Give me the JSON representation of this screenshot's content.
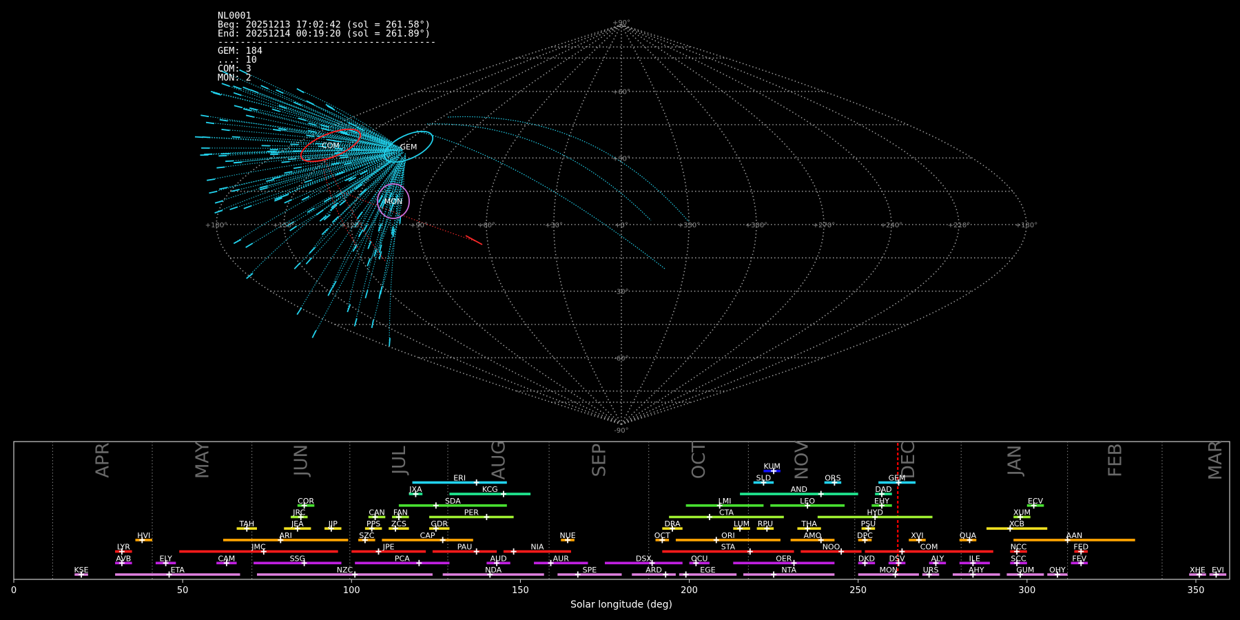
{
  "info": {
    "lines": [
      "NL0001",
      "Beg: 20251213 17:02:42 (sol = 261.58°)",
      "End: 20251214 00:19:20 (sol = 261.89°)",
      "---------------------------------------",
      "GEM: 184",
      "...: 10",
      "COM: 3",
      "MON: 2"
    ]
  },
  "colors": {
    "background": "#000000",
    "grid": "#9a9a9a",
    "meteor_gem": "#22d3ee",
    "meteor_com": "#ff2a2a",
    "radiant_gem": "#22d3ee",
    "radiant_com": "#ff2020",
    "radiant_mon": "#d070e0",
    "current_sol": "#ff0000"
  },
  "map": {
    "projection": "sinusoidal",
    "lat_labels": [
      "+90°",
      "+60°",
      "+30°",
      "-30°",
      "-60°",
      "-90°"
    ],
    "lon_labels": [
      "+180°",
      "+150°",
      "+120°",
      "+90°",
      "+60°",
      "+30°",
      "+0°",
      "+330°",
      "+300°",
      "+270°",
      "+240°",
      "+210°",
      "+180°"
    ],
    "radiants": [
      {
        "name": "COM",
        "color": "#ff2020"
      },
      {
        "name": "GEM",
        "color": "#22d3ee"
      },
      {
        "name": "MON",
        "color": "#d070e0"
      }
    ]
  },
  "chart_data": {
    "type": "timeline",
    "xlabel": "Solar longitude (deg)",
    "xlim": [
      0,
      360
    ],
    "xticks": [
      0,
      50,
      100,
      150,
      200,
      250,
      300,
      350
    ],
    "current_sol": [
      261.58,
      261.89
    ],
    "months": [
      {
        "name": "APR",
        "start": 11.5,
        "end": 41
      },
      {
        "name": "MAY",
        "start": 41,
        "end": 70.5
      },
      {
        "name": "JUN",
        "start": 70.5,
        "end": 99.5
      },
      {
        "name": "JUL",
        "start": 99.5,
        "end": 128.5
      },
      {
        "name": "AUG",
        "start": 128.5,
        "end": 158.5
      },
      {
        "name": "SEP",
        "start": 158.5,
        "end": 188
      },
      {
        "name": "OCT",
        "start": 188,
        "end": 217.5
      },
      {
        "name": "NOV",
        "start": 217.5,
        "end": 249
      },
      {
        "name": "DEC",
        "start": 249,
        "end": 280.5
      },
      {
        "name": "JAN",
        "start": 280.5,
        "end": 312
      },
      {
        "name": "FEB",
        "start": 312,
        "end": 340
      },
      {
        "name": "MAR",
        "start": 340,
        "end": 371.5
      }
    ],
    "showers": [
      {
        "name": "KUM",
        "start": 222,
        "end": 227,
        "peak": 225,
        "row": 9,
        "color": "#1010ff"
      },
      {
        "name": "ERI",
        "start": 118,
        "end": 146,
        "peak": 137,
        "row": 8,
        "color": "#22d3ee"
      },
      {
        "name": "SLD",
        "start": 219,
        "end": 225,
        "peak": 222,
        "row": 8,
        "color": "#22d3ee"
      },
      {
        "name": "ORS",
        "start": 240,
        "end": 245,
        "peak": 243,
        "row": 8,
        "color": "#22d3ee"
      },
      {
        "name": "GEM",
        "start": 256,
        "end": 267,
        "peak": 262,
        "row": 8,
        "color": "#22d3ee"
      },
      {
        "name": "JXA",
        "start": 117,
        "end": 121,
        "peak": 119,
        "row": 7,
        "color": "#20e890"
      },
      {
        "name": "KCG",
        "start": 129,
        "end": 153,
        "peak": 145,
        "row": 7,
        "color": "#20e890"
      },
      {
        "name": "AND",
        "start": 215,
        "end": 250,
        "peak": 239,
        "row": 7,
        "color": "#20e890"
      },
      {
        "name": "DAD",
        "start": 255,
        "end": 260,
        "peak": 257,
        "row": 7,
        "color": "#20e890"
      },
      {
        "name": "COR",
        "start": 84,
        "end": 89,
        "peak": 86,
        "row": 6,
        "color": "#48e030"
      },
      {
        "name": "SDA",
        "start": 114,
        "end": 146,
        "peak": 125,
        "row": 6,
        "color": "#48e030"
      },
      {
        "name": "LMI",
        "start": 199,
        "end": 222,
        "peak": 209,
        "row": 6,
        "color": "#48e030"
      },
      {
        "name": "LEO",
        "start": 224,
        "end": 246,
        "peak": 235,
        "row": 6,
        "color": "#48e030"
      },
      {
        "name": "EHY",
        "start": 254,
        "end": 260,
        "peak": 257,
        "row": 6,
        "color": "#48e030"
      },
      {
        "name": "ECV",
        "start": 300,
        "end": 305,
        "peak": 302,
        "row": 6,
        "color": "#48e030"
      },
      {
        "name": "JRC",
        "start": 82,
        "end": 87,
        "peak": 85,
        "row": 5,
        "color": "#a0f030"
      },
      {
        "name": "CAN",
        "start": 105,
        "end": 110,
        "peak": 107,
        "row": 5,
        "color": "#a0f030"
      },
      {
        "name": "FAN",
        "start": 112,
        "end": 117,
        "peak": 114,
        "row": 5,
        "color": "#a0f030"
      },
      {
        "name": "PER",
        "start": 123,
        "end": 148,
        "peak": 140,
        "row": 5,
        "color": "#a0f030"
      },
      {
        "name": "CTA",
        "start": 194,
        "end": 228,
        "peak": 206,
        "row": 5,
        "color": "#a0f030"
      },
      {
        "name": "HYD",
        "start": 238,
        "end": 272,
        "peak": 255,
        "row": 5,
        "color": "#a0f030"
      },
      {
        "name": "XUM",
        "start": 296,
        "end": 301,
        "peak": 298,
        "row": 5,
        "color": "#a0f030"
      },
      {
        "name": "TAH",
        "start": 66,
        "end": 72,
        "peak": 69,
        "row": 4,
        "color": "#f0e020"
      },
      {
        "name": "JEA",
        "start": 80,
        "end": 88,
        "peak": 84,
        "row": 4,
        "color": "#f0e020"
      },
      {
        "name": "JIP",
        "start": 92,
        "end": 97,
        "peak": 94,
        "row": 4,
        "color": "#f0e020"
      },
      {
        "name": "PPS",
        "start": 104,
        "end": 109,
        "peak": 106,
        "row": 4,
        "color": "#f0e020"
      },
      {
        "name": "ZCS",
        "start": 111,
        "end": 117,
        "peak": 113,
        "row": 4,
        "color": "#f0e020"
      },
      {
        "name": "GDR",
        "start": 123,
        "end": 129,
        "peak": 125,
        "row": 4,
        "color": "#f0e020"
      },
      {
        "name": "DRA",
        "start": 192,
        "end": 198,
        "peak": 195,
        "row": 4,
        "color": "#f0e020"
      },
      {
        "name": "LUM",
        "start": 213,
        "end": 218,
        "peak": 215,
        "row": 4,
        "color": "#f0e020"
      },
      {
        "name": "RPU",
        "start": 220,
        "end": 225,
        "peak": 223,
        "row": 4,
        "color": "#f0e020"
      },
      {
        "name": "THA",
        "start": 232,
        "end": 239,
        "peak": 235,
        "row": 4,
        "color": "#f0e020"
      },
      {
        "name": "PSU",
        "start": 251,
        "end": 255,
        "peak": 253,
        "row": 4,
        "color": "#f0e020"
      },
      {
        "name": "XCB",
        "start": 288,
        "end": 306,
        "peak": 295,
        "row": 4,
        "color": "#f0e020"
      },
      {
        "name": "HVI",
        "start": 36,
        "end": 41,
        "peak": 38,
        "row": 3,
        "color": "#ffa500"
      },
      {
        "name": "ARI",
        "start": 62,
        "end": 99,
        "peak": 79,
        "row": 3,
        "color": "#ffa500"
      },
      {
        "name": "SZC",
        "start": 102,
        "end": 107,
        "peak": 104,
        "row": 3,
        "color": "#ffa500"
      },
      {
        "name": "CAP",
        "start": 109,
        "end": 136,
        "peak": 127,
        "row": 3,
        "color": "#ffa500"
      },
      {
        "name": "NUE",
        "start": 162,
        "end": 166,
        "peak": 164,
        "row": 3,
        "color": "#ffa500"
      },
      {
        "name": "OCT",
        "start": 190,
        "end": 194,
        "peak": 192,
        "row": 3,
        "color": "#ffa500"
      },
      {
        "name": "ORI",
        "start": 196,
        "end": 227,
        "peak": 208,
        "row": 3,
        "color": "#ffa500"
      },
      {
        "name": "AMO",
        "start": 230,
        "end": 243,
        "peak": 239,
        "row": 3,
        "color": "#ffa500"
      },
      {
        "name": "DPC",
        "start": 250,
        "end": 254,
        "peak": 252,
        "row": 3,
        "color": "#ffa500"
      },
      {
        "name": "XVI",
        "start": 265,
        "end": 270,
        "peak": 268,
        "row": 3,
        "color": "#ffa500"
      },
      {
        "name": "QUA",
        "start": 280,
        "end": 285,
        "peak": 283,
        "row": 3,
        "color": "#ffa500"
      },
      {
        "name": "AAN",
        "start": 296,
        "end": 332,
        "peak": 312,
        "row": 3,
        "color": "#ffa500"
      },
      {
        "name": "LYR",
        "start": 30,
        "end": 35,
        "peak": 32,
        "row": 2,
        "color": "#ff1a1a"
      },
      {
        "name": "JMC",
        "start": 49,
        "end": 96,
        "peak": 74,
        "row": 2,
        "color": "#ff1a1a"
      },
      {
        "name": "JPE",
        "start": 100,
        "end": 122,
        "peak": 108,
        "row": 2,
        "color": "#ff1a1a"
      },
      {
        "name": "PAU",
        "start": 124,
        "end": 143,
        "peak": 137,
        "row": 2,
        "color": "#ff1a1a"
      },
      {
        "name": "NIA",
        "start": 145,
        "end": 165,
        "peak": 148,
        "row": 2,
        "color": "#ff1a1a"
      },
      {
        "name": "STA",
        "start": 192,
        "end": 231,
        "peak": 218,
        "row": 2,
        "color": "#ff1a1a"
      },
      {
        "name": "NOO",
        "start": 233,
        "end": 251,
        "peak": 245,
        "row": 2,
        "color": "#ff1a1a"
      },
      {
        "name": "COM",
        "start": 252,
        "end": 290,
        "peak": 263,
        "row": 2,
        "color": "#ff1a1a"
      },
      {
        "name": "NCC",
        "start": 295,
        "end": 300,
        "peak": 297,
        "row": 2,
        "color": "#ff1a1a"
      },
      {
        "name": "FED",
        "start": 314,
        "end": 318,
        "peak": 316,
        "row": 2,
        "color": "#ff1a1a"
      },
      {
        "name": "AVB",
        "start": 30,
        "end": 35,
        "peak": 32,
        "row": 1,
        "color": "#c020e0"
      },
      {
        "name": "ELY",
        "start": 42,
        "end": 48,
        "peak": 45,
        "row": 1,
        "color": "#c020e0"
      },
      {
        "name": "CAM",
        "start": 60,
        "end": 66,
        "peak": 63,
        "row": 1,
        "color": "#c020e0"
      },
      {
        "name": "SSG",
        "start": 71,
        "end": 97,
        "peak": 86,
        "row": 1,
        "color": "#c020e0"
      },
      {
        "name": "PCA",
        "start": 101,
        "end": 129,
        "peak": 120,
        "row": 1,
        "color": "#c020e0"
      },
      {
        "name": "AUD",
        "start": 140,
        "end": 147,
        "peak": 143,
        "row": 1,
        "color": "#c020e0"
      },
      {
        "name": "AUR",
        "start": 154,
        "end": 170,
        "peak": 159,
        "row": 1,
        "color": "#c020e0"
      },
      {
        "name": "DSX",
        "start": 175,
        "end": 198,
        "peak": 189,
        "row": 1,
        "color": "#c020e0"
      },
      {
        "name": "OCU",
        "start": 200,
        "end": 206,
        "peak": 202,
        "row": 1,
        "color": "#c020e0"
      },
      {
        "name": "OER",
        "start": 213,
        "end": 243,
        "peak": 231,
        "row": 1,
        "color": "#c020e0"
      },
      {
        "name": "DKD",
        "start": 250,
        "end": 255,
        "peak": 252,
        "row": 1,
        "color": "#c020e0"
      },
      {
        "name": "DSV",
        "start": 259,
        "end": 264,
        "peak": 262,
        "row": 1,
        "color": "#c020e0"
      },
      {
        "name": "ALY",
        "start": 271,
        "end": 276,
        "peak": 273,
        "row": 1,
        "color": "#c020e0"
      },
      {
        "name": "ILE",
        "start": 280,
        "end": 289,
        "peak": 284,
        "row": 1,
        "color": "#c020e0"
      },
      {
        "name": "SCC",
        "start": 295,
        "end": 300,
        "peak": 297,
        "row": 1,
        "color": "#c020e0"
      },
      {
        "name": "FEV",
        "start": 313,
        "end": 318,
        "peak": 316,
        "row": 1,
        "color": "#c020e0"
      },
      {
        "name": "KSE",
        "start": 18,
        "end": 22,
        "peak": 20,
        "row": 0,
        "color": "#e080e0"
      },
      {
        "name": "ETA",
        "start": 30,
        "end": 67,
        "peak": 46,
        "row": 0,
        "color": "#e080e0"
      },
      {
        "name": "NZC",
        "start": 72,
        "end": 124,
        "peak": 101,
        "row": 0,
        "color": "#e080e0"
      },
      {
        "name": "NDA",
        "start": 127,
        "end": 157,
        "peak": 141,
        "row": 0,
        "color": "#e080e0"
      },
      {
        "name": "SPE",
        "start": 161,
        "end": 180,
        "peak": 167,
        "row": 0,
        "color": "#e080e0"
      },
      {
        "name": "ARD",
        "start": 183,
        "end": 196,
        "peak": 193,
        "row": 0,
        "color": "#e080e0"
      },
      {
        "name": "EGE",
        "start": 197,
        "end": 214,
        "peak": 199,
        "row": 0,
        "color": "#e080e0"
      },
      {
        "name": "NTA",
        "start": 216,
        "end": 243,
        "peak": 225,
        "row": 0,
        "color": "#e080e0"
      },
      {
        "name": "MON",
        "start": 250,
        "end": 268,
        "peak": 261,
        "row": 0,
        "color": "#e080e0"
      },
      {
        "name": "URS",
        "start": 269,
        "end": 274,
        "peak": 271,
        "row": 0,
        "color": "#e080e0"
      },
      {
        "name": "AHY",
        "start": 278,
        "end": 292,
        "peak": 284,
        "row": 0,
        "color": "#e080e0"
      },
      {
        "name": "GUM",
        "start": 294,
        "end": 305,
        "peak": 298,
        "row": 0,
        "color": "#e080e0"
      },
      {
        "name": "OHY",
        "start": 306,
        "end": 312,
        "peak": 309,
        "row": 0,
        "color": "#e080e0"
      },
      {
        "name": "XHE",
        "start": 348,
        "end": 353,
        "peak": 351,
        "row": 0,
        "color": "#e080e0"
      },
      {
        "name": "EVI",
        "start": 354,
        "end": 359,
        "peak": 356,
        "row": 0,
        "color": "#e080e0"
      }
    ]
  }
}
